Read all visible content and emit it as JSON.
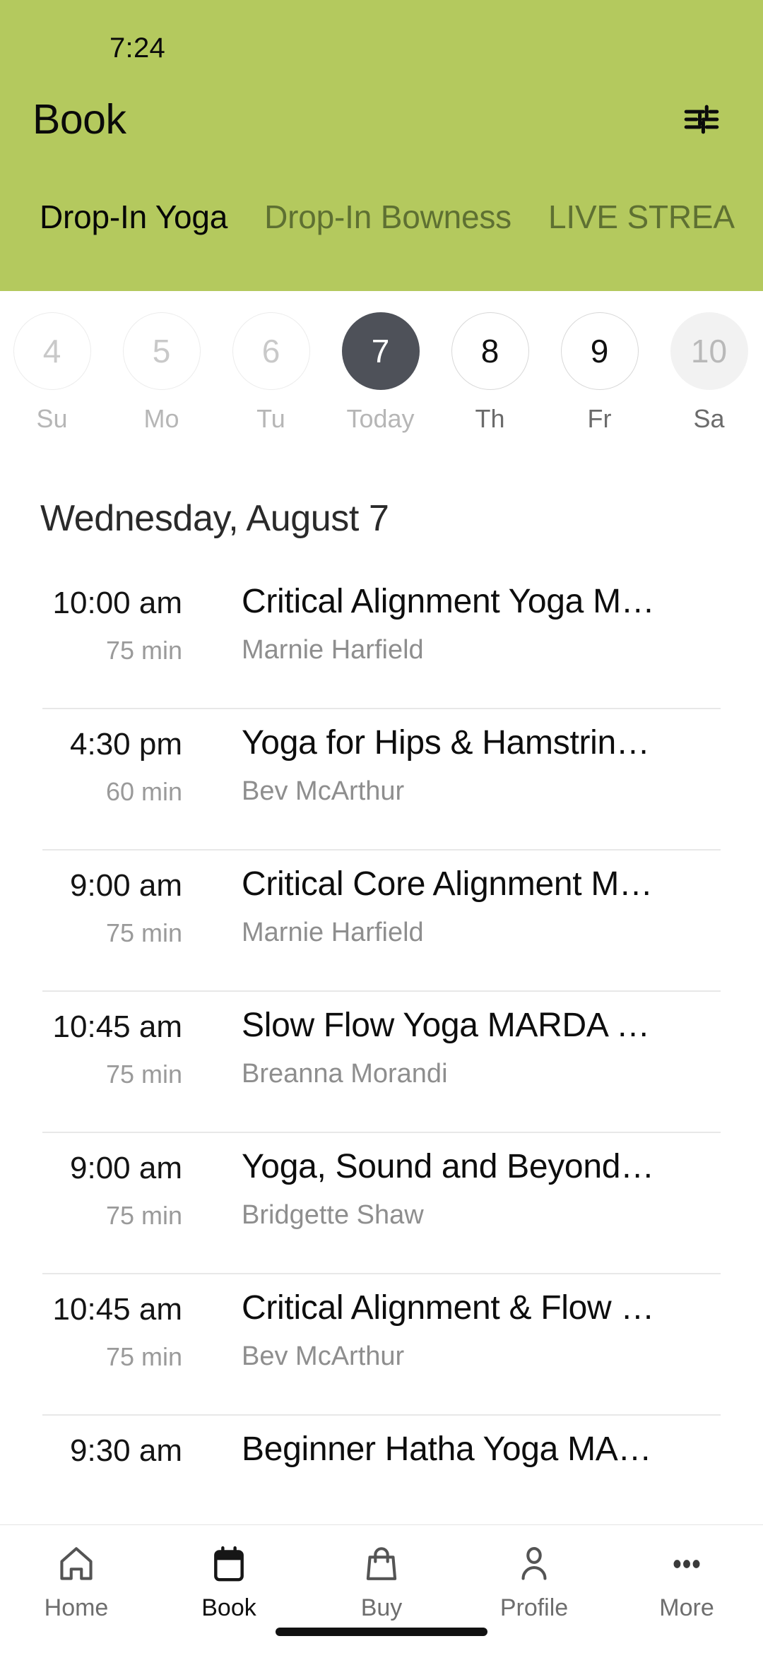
{
  "status": {
    "time": "7:24"
  },
  "header": {
    "title": "Book",
    "filter_icon": "tune-icon",
    "background_color": "#b4c95e",
    "tabs": [
      {
        "label": "Drop-In Yoga",
        "active": true
      },
      {
        "label": "Drop-In Bowness",
        "active": false
      },
      {
        "label": "LIVE STREA",
        "active": false
      }
    ]
  },
  "date_strip": {
    "days": [
      {
        "num": "4",
        "weekday": "Su",
        "state": "past"
      },
      {
        "num": "5",
        "weekday": "Mo",
        "state": "past"
      },
      {
        "num": "6",
        "weekday": "Tu",
        "state": "past"
      },
      {
        "num": "7",
        "weekday": "Today",
        "state": "today"
      },
      {
        "num": "8",
        "weekday": "Th",
        "state": "future"
      },
      {
        "num": "9",
        "weekday": "Fr",
        "state": "future"
      },
      {
        "num": "10",
        "weekday": "Sa",
        "state": "dim"
      }
    ],
    "selected_color": "#4e5159"
  },
  "schedule": {
    "heading": "Wednesday, August 7",
    "classes": [
      {
        "time": "10:00 am",
        "duration": "75 min",
        "name": "Critical Alignment Yoga M…",
        "teacher": "Marnie Harfield"
      },
      {
        "time": "4:30 pm",
        "duration": "60 min",
        "name": "Yoga for Hips & Hamstrin…",
        "teacher": "Bev McArthur"
      },
      {
        "time": "9:00 am",
        "duration": "75 min",
        "name": "Critical Core Alignment M…",
        "teacher": "Marnie Harfield"
      },
      {
        "time": "10:45 am",
        "duration": "75 min",
        "name": "Slow Flow Yoga MARDA …",
        "teacher": "Breanna Morandi"
      },
      {
        "time": "9:00 am",
        "duration": "75 min",
        "name": "Yoga, Sound and Beyond…",
        "teacher": "Bridgette Shaw"
      },
      {
        "time": "10:45 am",
        "duration": "75 min",
        "name": "Critical Alignment & Flow …",
        "teacher": "Bev McArthur"
      },
      {
        "time": "9:30 am",
        "duration": "",
        "name": "Beginner Hatha Yoga MA…",
        "teacher": ""
      }
    ]
  },
  "bottom_nav": {
    "items": [
      {
        "label": "Home",
        "icon": "home-icon",
        "active": false
      },
      {
        "label": "Book",
        "icon": "calendar-icon",
        "active": true
      },
      {
        "label": "Buy",
        "icon": "bag-icon",
        "active": false
      },
      {
        "label": "Profile",
        "icon": "person-icon",
        "active": false
      },
      {
        "label": "More",
        "icon": "ellipsis-icon",
        "active": false
      }
    ]
  }
}
